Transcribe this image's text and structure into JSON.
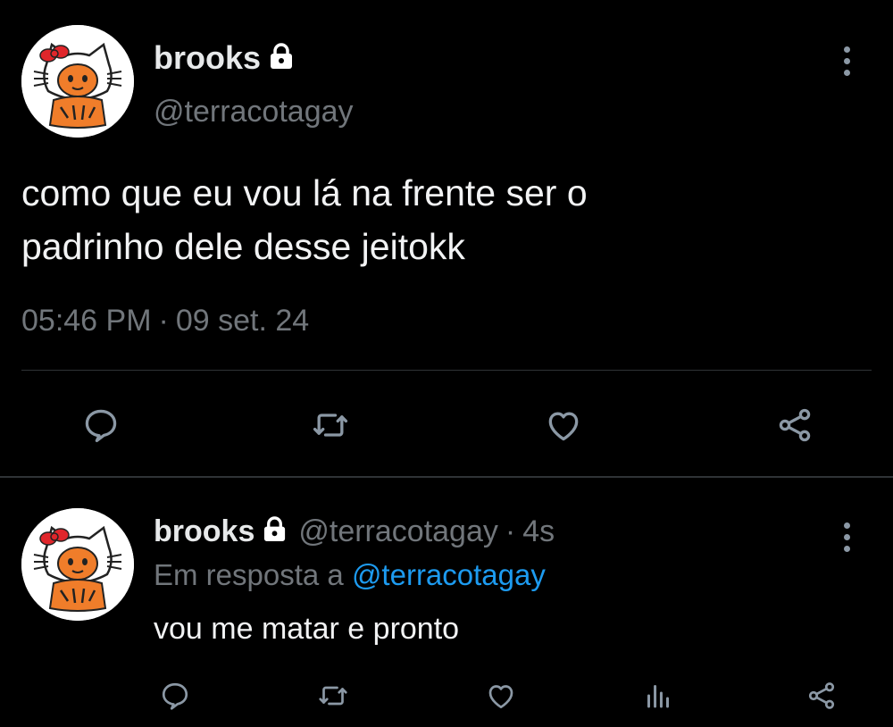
{
  "main_tweet": {
    "display_name": "brooks",
    "handle": "@terracotagay",
    "text_line1": "como que eu vou lá na frente ser o",
    "text_line2": "padrinho dele desse jeitokk",
    "time": "05:46 PM",
    "separator": "·",
    "date": "09 set. 24",
    "icons": [
      "lock-icon",
      "more-vertical-icon",
      "reply-icon",
      "retweet-icon",
      "like-icon",
      "share-icon"
    ]
  },
  "reply_tweet": {
    "display_name": "brooks",
    "handle": "@terracotagay",
    "separator": "·",
    "age": "4s",
    "reply_prefix": "Em resposta a",
    "reply_mention": "@terracotagay",
    "text": "vou me matar e pronto",
    "icons": [
      "lock-icon",
      "more-vertical-icon",
      "reply-icon",
      "retweet-icon",
      "like-icon",
      "analytics-icon",
      "share-icon"
    ]
  },
  "colors": {
    "background": "#000000",
    "text_primary": "#e7e9ea",
    "text_secondary": "#71767b",
    "link": "#1d9bf0",
    "divider": "#2f3336",
    "icon": "#8b98a5"
  }
}
